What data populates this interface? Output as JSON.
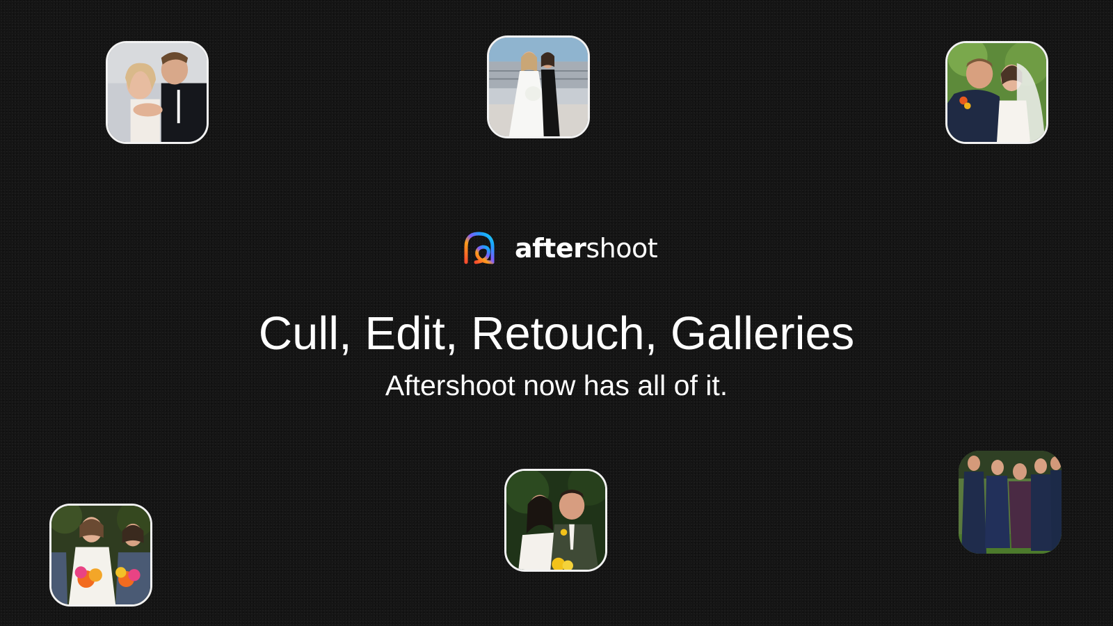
{
  "brand": {
    "name_bold": "after",
    "name_regular": "shoot",
    "logo_icon": "aftershoot-logo-icon"
  },
  "hero": {
    "headline": "Cull, Edit, Retouch, Galleries",
    "subheadline": "Aftershoot now has all of it."
  },
  "photos": [
    {
      "subject": "couple-kissing-photo"
    },
    {
      "subject": "bride-with-bridesmaid-photo"
    },
    {
      "subject": "bride-and-groom-embrace-photo"
    },
    {
      "subject": "bride-with-bridesmaids-bouquets-photo"
    },
    {
      "subject": "bride-and-groom-portrait-photo"
    },
    {
      "subject": "groomsmen-group-photo"
    }
  ],
  "colors": {
    "background": "#151515",
    "text": "#ffffff",
    "photo_border": "#f2f2f2"
  }
}
